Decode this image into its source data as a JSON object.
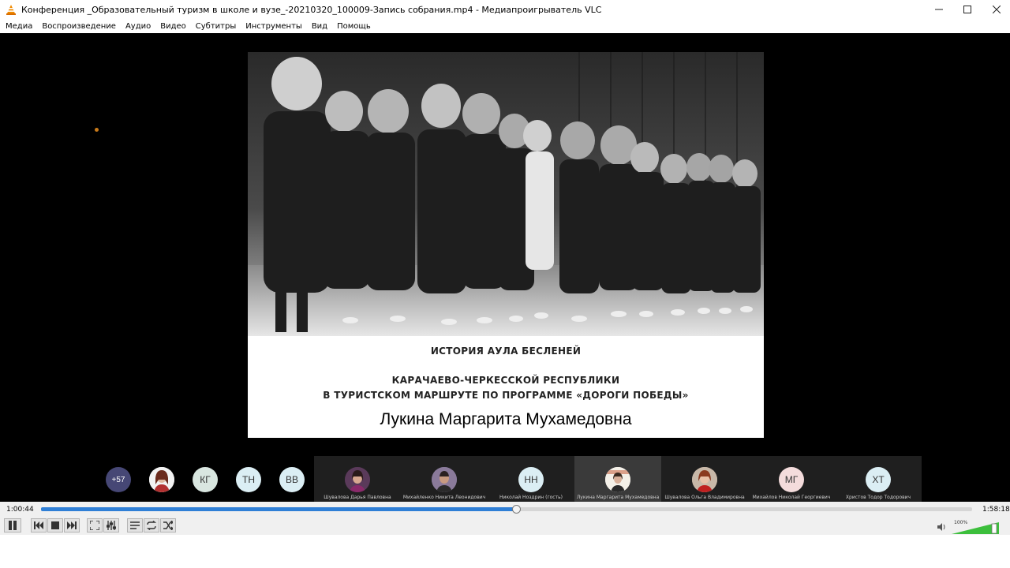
{
  "window": {
    "title": "Конференция _Образовательный туризм в школе и вузе_-20210320_100009-Запись собрания.mp4 - Медиапроигрыватель VLC",
    "app_icon": "vlc-cone-icon",
    "controls": [
      "minimize-icon",
      "maximize-icon",
      "close-icon"
    ]
  },
  "menu": [
    "Медиа",
    "Воспроизведение",
    "Аудио",
    "Видео",
    "Субтитры",
    "Инструменты",
    "Вид",
    "Помощь"
  ],
  "slide": {
    "caption_1": "ИСТОРИЯ АУЛА БЕСЛЕНЕЙ",
    "caption_2": "КАРАЧАЕВО-ЧЕРКЕССКОЙ РЕСПУБЛИКИ",
    "caption_3": "В ТУРИСТСКОМ МАРШРУТЕ  ПО ПРОГРАММЕ «ДОРОГИ ПОБЕДЫ»",
    "author": "Лукина Маргарита Мухамедовна"
  },
  "participants": {
    "overflow": "+57",
    "circles": [
      "КГ",
      "ТН",
      "ВВ"
    ],
    "tiles": [
      {
        "initials": "",
        "name": "Шувалова Дарья Павловна"
      },
      {
        "initials": "",
        "name": "Михайленко Никита Леонидович"
      },
      {
        "initials": "НН",
        "name": "Николай Ноздрин (гость)"
      },
      {
        "initials": "",
        "name": "Лукина Маргарита Мухамедовна"
      },
      {
        "initials": "",
        "name": "Шувалова Ольга Владимировна"
      },
      {
        "initials": "МГ",
        "name": "Михайлов Николай Георгиевич"
      },
      {
        "initials": "ХТ",
        "name": "Христов Тодор Тодорович"
      }
    ]
  },
  "player": {
    "elapsed": "1:00:44",
    "total": "1:58:18",
    "progress": 0.51,
    "volume_label": "100%",
    "volume": 1.0,
    "accent": "#2f7fd6"
  }
}
